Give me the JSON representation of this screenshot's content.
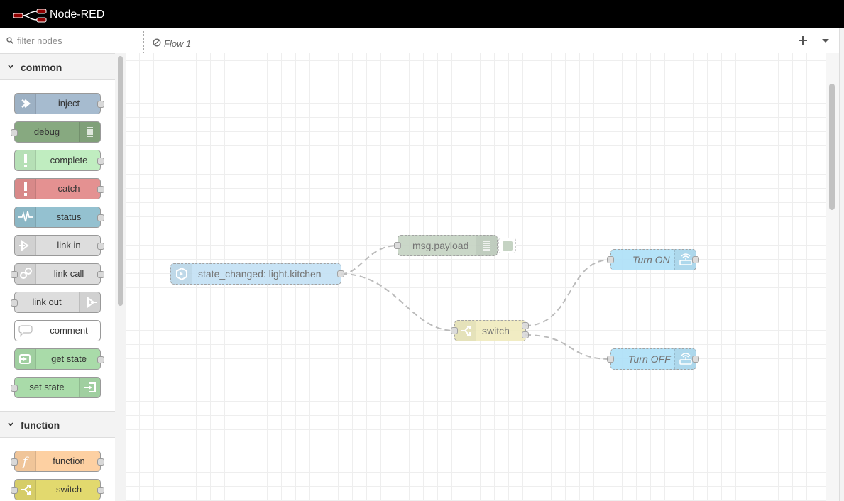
{
  "header": {
    "title": "Node-RED"
  },
  "palette": {
    "search_placeholder": "filter nodes",
    "categories": [
      {
        "label": "common",
        "nodes": [
          {
            "label": "inject",
            "color": "#a6bbcf",
            "icon": "arrow-in-icon"
          },
          {
            "label": "debug",
            "color": "#87a980",
            "icon": "list-icon"
          },
          {
            "label": "complete",
            "color": "#c0edc0",
            "icon": "exclamation-icon"
          },
          {
            "label": "catch",
            "color": "#e49191",
            "icon": "exclamation-icon"
          },
          {
            "label": "status",
            "color": "#94c1d0",
            "icon": "pulse-icon"
          },
          {
            "label": "link in",
            "color": "#dddddd",
            "icon": "link-in-icon"
          },
          {
            "label": "link call",
            "color": "#dddddd",
            "icon": "link-call-icon"
          },
          {
            "label": "link out",
            "color": "#dddddd",
            "icon": "link-out-icon"
          },
          {
            "label": "comment",
            "color": "#ffffff",
            "icon": "comment-icon"
          },
          {
            "label": "get state",
            "color": "#a9dba9",
            "icon": "sign-in-icon"
          },
          {
            "label": "set state",
            "color": "#a9dba9",
            "icon": "sign-in-icon"
          }
        ]
      },
      {
        "label": "function",
        "nodes": [
          {
            "label": "function",
            "color": "#fdd0a2",
            "icon": "function-icon"
          },
          {
            "label": "switch",
            "color": "#e2d96e",
            "icon": "switch-icon"
          }
        ]
      }
    ]
  },
  "workspace": {
    "tab_label": "Flow 1",
    "nodes": {
      "state_changed": {
        "label": "state_changed: light.kitchen",
        "color": "#c3e1f4"
      },
      "msg_payload": {
        "label": "msg.payload",
        "color": "#c5d3c3"
      },
      "switch": {
        "label": "switch",
        "color": "#f0ebbd"
      },
      "turn_on": {
        "label": "Turn ON",
        "color": "#aee0f8"
      },
      "turn_off": {
        "label": "Turn OFF",
        "color": "#aee0f8"
      }
    }
  }
}
